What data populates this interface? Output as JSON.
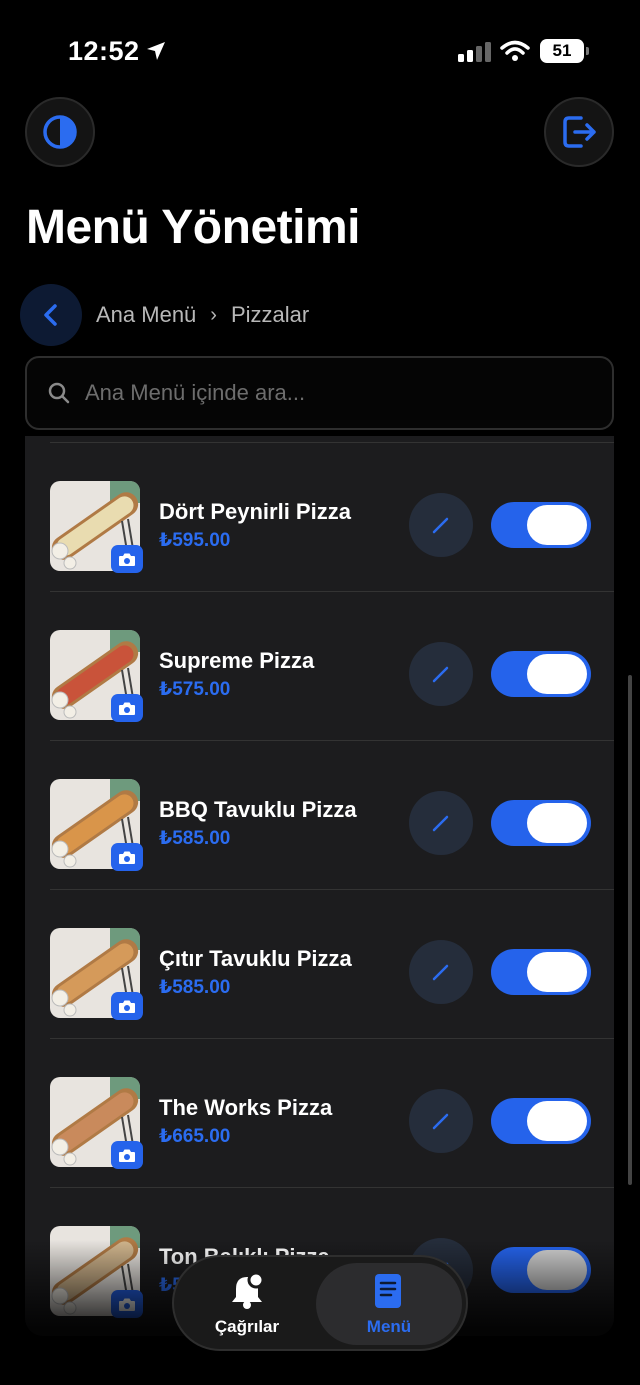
{
  "status_bar": {
    "time": "12:52",
    "battery": "51"
  },
  "header": {
    "title": "Menü Yönetimi"
  },
  "breadcrumb": {
    "root": "Ana Menü",
    "separator": "›",
    "current": "Pizzalar"
  },
  "search": {
    "placeholder": "Ana Menü içinde ara..."
  },
  "items": [
    {
      "name": "Dört Peynirli Pizza",
      "price": "₺595.00",
      "enabled": true
    },
    {
      "name": "Supreme Pizza",
      "price": "₺575.00",
      "enabled": true
    },
    {
      "name": "BBQ Tavuklu Pizza",
      "price": "₺585.00",
      "enabled": true
    },
    {
      "name": "Çıtır Tavuklu Pizza",
      "price": "₺585.00",
      "enabled": true
    },
    {
      "name": "The Works Pizza",
      "price": "₺665.00",
      "enabled": true
    },
    {
      "name": "Ton Balıklı Pizza",
      "price": "₺5...",
      "enabled": true
    }
  ],
  "tabbar": {
    "calls_label": "Çağrılar",
    "menu_label": "Menü",
    "active": "menu"
  },
  "colors": {
    "accent": "#2563eb",
    "background": "#000000",
    "card": "#1c1c1e"
  }
}
